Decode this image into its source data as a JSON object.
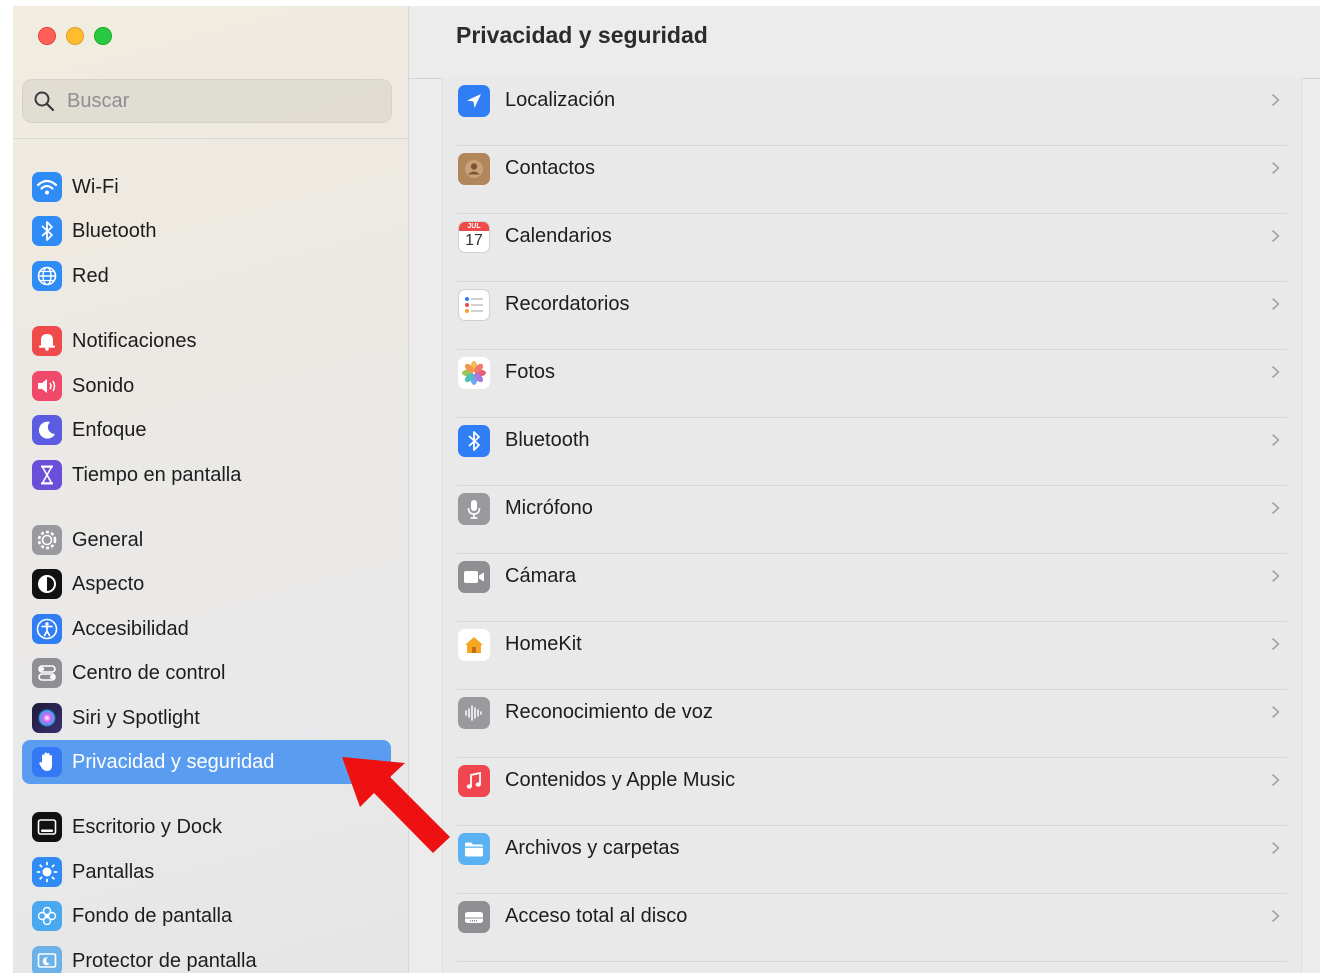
{
  "window_title": "Privacidad y seguridad",
  "search": {
    "placeholder": "Buscar"
  },
  "sidebar": {
    "items": [
      {
        "label": "Wi-Fi",
        "icon": "wifi-icon",
        "color": "#2f8bf5"
      },
      {
        "label": "Bluetooth",
        "icon": "bluetooth-icon",
        "color": "#2f8bf5"
      },
      {
        "label": "Red",
        "icon": "globe-icon",
        "color": "#2f8bf5"
      },
      {
        "label": "Notificaciones",
        "icon": "bell-icon",
        "color": "#f04a4a"
      },
      {
        "label": "Sonido",
        "icon": "speaker-icon",
        "color": "#f04a6a"
      },
      {
        "label": "Enfoque",
        "icon": "moon-icon",
        "color": "#5b5ce0"
      },
      {
        "label": "Tiempo en pantalla",
        "icon": "hourglass-icon",
        "color": "#6b4fd8"
      },
      {
        "label": "General",
        "icon": "gear-icon",
        "color": "#9a9a9e"
      },
      {
        "label": "Aspecto",
        "icon": "appearance-icon",
        "color": "#111111"
      },
      {
        "label": "Accesibilidad",
        "icon": "accessibility-icon",
        "color": "#2f7ef5"
      },
      {
        "label": "Centro de control",
        "icon": "control-center-icon",
        "color": "#8e8e93"
      },
      {
        "label": "Siri y Spotlight",
        "icon": "siri-icon",
        "color": "#3a3a6a"
      },
      {
        "label": "Privacidad y seguridad",
        "icon": "hand-icon",
        "color": "#3478f6",
        "active": true
      },
      {
        "label": "Escritorio y Dock",
        "icon": "dock-icon",
        "color": "#111111"
      },
      {
        "label": "Pantallas",
        "icon": "sun-icon",
        "color": "#2f8bf5"
      },
      {
        "label": "Fondo de pantalla",
        "icon": "flower-icon",
        "color": "#4aa8f0"
      },
      {
        "label": "Protector de pantalla",
        "icon": "screensaver-icon",
        "color": "#6cb2e8"
      }
    ]
  },
  "privacy_list": [
    {
      "label": "Localización",
      "icon": "location-arrow-icon",
      "color": "#2f7ef5"
    },
    {
      "label": "Contactos",
      "icon": "contacts-icon",
      "color": "#b0865a"
    },
    {
      "label": "Calendarios",
      "icon": "calendar-icon",
      "color": "#ffffff",
      "month": "JUL",
      "day": "17"
    },
    {
      "label": "Recordatorios",
      "icon": "reminders-icon",
      "color": "#ffffff"
    },
    {
      "label": "Fotos",
      "icon": "photos-icon",
      "color": "#ffffff"
    },
    {
      "label": "Bluetooth",
      "icon": "bluetooth-icon",
      "color": "#2f7ef5"
    },
    {
      "label": "Micrófono",
      "icon": "microphone-icon",
      "color": "#9a9a9e"
    },
    {
      "label": "Cámara",
      "icon": "camera-icon",
      "color": "#8e8e93"
    },
    {
      "label": "HomeKit",
      "icon": "home-icon",
      "color": "#ffffff"
    },
    {
      "label": "Reconocimiento de voz",
      "icon": "waveform-icon",
      "color": "#9a9a9e"
    },
    {
      "label": "Contenidos y Apple Music",
      "icon": "music-note-icon",
      "color": "#f0464f"
    },
    {
      "label": "Archivos y carpetas",
      "icon": "folder-icon",
      "color": "#5ab2f2"
    },
    {
      "label": "Acceso total al disco",
      "icon": "disk-icon",
      "color": "#8e8e93"
    }
  ],
  "annotation": {
    "icon": "red-arrow-icon",
    "color": "#ee1111"
  }
}
